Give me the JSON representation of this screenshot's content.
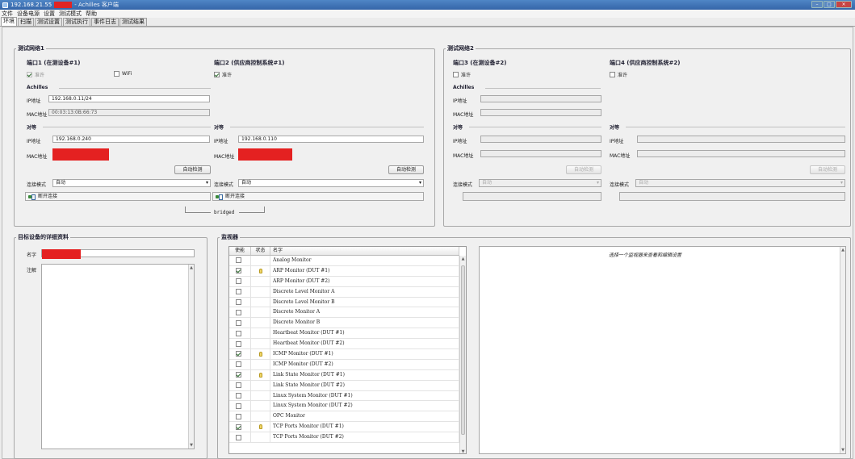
{
  "window": {
    "ip": "192.168.21.55",
    "app_name": "- Achilles 客户端"
  },
  "menu": [
    "文件",
    "设备电源",
    "设置",
    "测试模式",
    "帮助"
  ],
  "tabs": [
    "环境",
    "扫描",
    "测试设置",
    "测试执行",
    "事件日志",
    "测试结果"
  ],
  "network1": {
    "legend": "测试网络1",
    "port1": {
      "title": "端口1 (在测设备#1)",
      "allow_label": "准许",
      "allow_checked": true,
      "wifi_label": "WiFi",
      "achilles_label": "Achilles",
      "ip_label": "IP地址",
      "ip_value": "192.168.0.11/24",
      "mac_label": "MAC地址",
      "mac_value": "00:03:13:0B:66:73",
      "peer_label": "对等",
      "peer_ip_label": "IP地址",
      "peer_ip_value": "192.168.0.240",
      "peer_mac_label": "MAC地址",
      "autodetect_label": "自动检测",
      "mode_label": "连接模式",
      "mode_value": "自动",
      "disconnect_label": "断开连接"
    },
    "port2": {
      "title": "端口2 (供应商控制系统#1)",
      "allow_label": "准许",
      "allow_checked": true,
      "peer_label": "对等",
      "peer_ip_label": "IP地址",
      "peer_ip_value": "192.168.0.110",
      "peer_mac_label": "MAC地址",
      "autodetect_label": "自动检测",
      "mode_label": "连接模式",
      "mode_value": "自动",
      "disconnect_label": "断开连接"
    },
    "bridged_label": "bridged"
  },
  "network2": {
    "legend": "测试网络2",
    "port3": {
      "title": "端口3 (在测设备#2)",
      "allow_label": "准许",
      "achilles_label": "Achilles",
      "ip_label": "IP地址",
      "mac_label": "MAC地址",
      "peer_label": "对等",
      "peer_ip_label": "IP地址",
      "peer_mac_label": "MAC地址",
      "autodetect_label": "自动检测",
      "mode_label": "连接模式",
      "mode_value": "自动"
    },
    "port4": {
      "title": "端口4 (供应商控制系统#2)",
      "allow_label": "准许",
      "peer_label": "对等",
      "peer_ip_label": "IP地址",
      "peer_mac_label": "MAC地址",
      "autodetect_label": "自动检测",
      "mode_label": "连接模式",
      "mode_value": "自动"
    }
  },
  "target": {
    "legend": "目标设备的详细资料",
    "name_label": "名字",
    "notes_label": "注解"
  },
  "monitors": {
    "legend": "监视器",
    "headers": [
      "使能",
      "状态",
      "名字"
    ],
    "rows": [
      {
        "enabled": false,
        "status": false,
        "name": "Analog Monitor"
      },
      {
        "enabled": true,
        "status": true,
        "name": "ARP Monitor (DUT #1)"
      },
      {
        "enabled": false,
        "status": false,
        "name": "ARP Monitor (DUT #2)"
      },
      {
        "enabled": false,
        "status": false,
        "name": "Discrete Level Monitor A"
      },
      {
        "enabled": false,
        "status": false,
        "name": "Discrete Level Monitor B"
      },
      {
        "enabled": false,
        "status": false,
        "name": "Discrete Monitor A"
      },
      {
        "enabled": false,
        "status": false,
        "name": "Discrete Monitor B"
      },
      {
        "enabled": false,
        "status": false,
        "name": "Heartbeat Monitor (DUT #1)"
      },
      {
        "enabled": false,
        "status": false,
        "name": "Heartbeat Monitor (DUT #2)"
      },
      {
        "enabled": true,
        "status": true,
        "name": "ICMP Monitor (DUT #1)"
      },
      {
        "enabled": false,
        "status": false,
        "name": "ICMP Monitor (DUT #2)"
      },
      {
        "enabled": true,
        "status": true,
        "name": "Link State Monitor (DUT #1)"
      },
      {
        "enabled": false,
        "status": false,
        "name": "Link State Monitor (DUT #2)"
      },
      {
        "enabled": false,
        "status": false,
        "name": "Linux System Monitor (DUT #1)"
      },
      {
        "enabled": false,
        "status": false,
        "name": "Linux System Monitor (DUT #2)"
      },
      {
        "enabled": false,
        "status": false,
        "name": "OPC Monitor"
      },
      {
        "enabled": true,
        "status": true,
        "name": "TCP Ports Monitor (DUT #1)"
      },
      {
        "enabled": false,
        "status": false,
        "name": "TCP Ports Monitor (DUT #2)"
      }
    ],
    "detail_message": "选择一个监视器来查看和编辑设置"
  }
}
